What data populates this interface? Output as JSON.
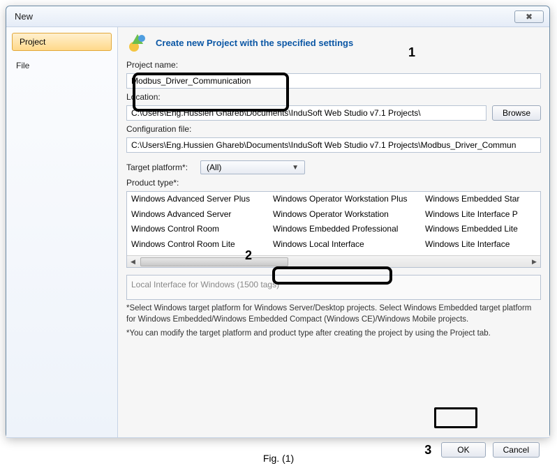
{
  "window": {
    "title": "New"
  },
  "sidebar": {
    "items": [
      {
        "label": "Project"
      },
      {
        "label": "File"
      }
    ]
  },
  "heading": "Create new Project with the specified settings",
  "annotations": {
    "one": "1",
    "two": "2",
    "three": "3"
  },
  "fields": {
    "project_name_label": "Project name:",
    "project_name_value": "Modbus_Driver_Communication",
    "location_label": "Location:",
    "location_value": "C:\\Users\\Eng.Hussien Ghareb\\Documents\\InduSoft Web Studio v7.1 Projects\\",
    "browse_label": "Browse",
    "config_label": "Configuration file:",
    "config_value": "C:\\Users\\Eng.Hussien Ghareb\\Documents\\InduSoft Web Studio v7.1 Projects\\Modbus_Driver_Commun",
    "target_label": "Target platform*:",
    "target_value": "(All)",
    "product_type_label": "Product type*:"
  },
  "product_types": {
    "col1": [
      "Windows Advanced Server Plus",
      "Windows Advanced Server",
      "Windows Control Room",
      "Windows Control Room Lite"
    ],
    "col2": [
      "Windows Operator Workstation Plus",
      "Windows Operator Workstation",
      "Windows Embedded Professional",
      "Windows Local Interface"
    ],
    "col3": [
      "Windows Embedded Star",
      "Windows Lite Interface P",
      "Windows Embedded Lite",
      "Windows Lite Interface"
    ]
  },
  "description": "Local Interface for Windows (1500 tags)",
  "notes": {
    "a": "*Select Windows target platform for Windows Server/Desktop projects. Select Windows Embedded target platform for Windows Embedded/Windows Embedded Compact (Windows CE)/Windows Mobile projects.",
    "b": "*You can modify the target platform and product type after creating the project by using the Project tab."
  },
  "buttons": {
    "ok": "OK",
    "cancel": "Cancel"
  },
  "caption": "Fig. (1)"
}
